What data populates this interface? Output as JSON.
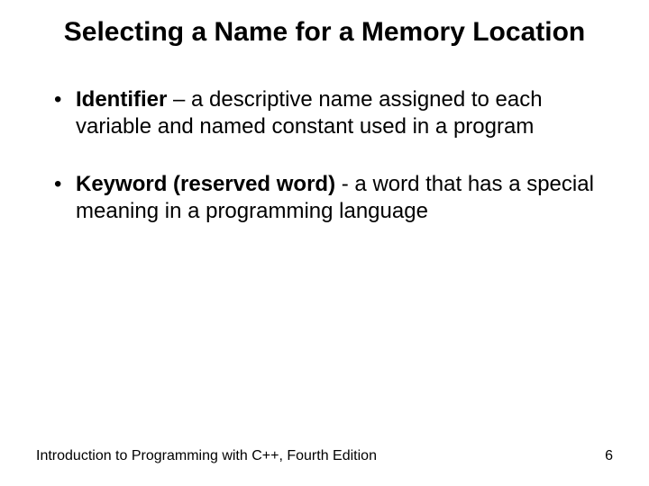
{
  "title": "Selecting a Name for a Memory Location",
  "bullets": [
    {
      "term": "Identifier",
      "sep": " – ",
      "def": "a descriptive name assigned to each variable and named constant used in a program"
    },
    {
      "term": "Keyword (reserved word)",
      "sep": " - ",
      "def": "a word that has a special meaning in a programming language"
    }
  ],
  "footer": {
    "text": "Introduction to Programming with C++, Fourth Edition",
    "page": "6"
  }
}
